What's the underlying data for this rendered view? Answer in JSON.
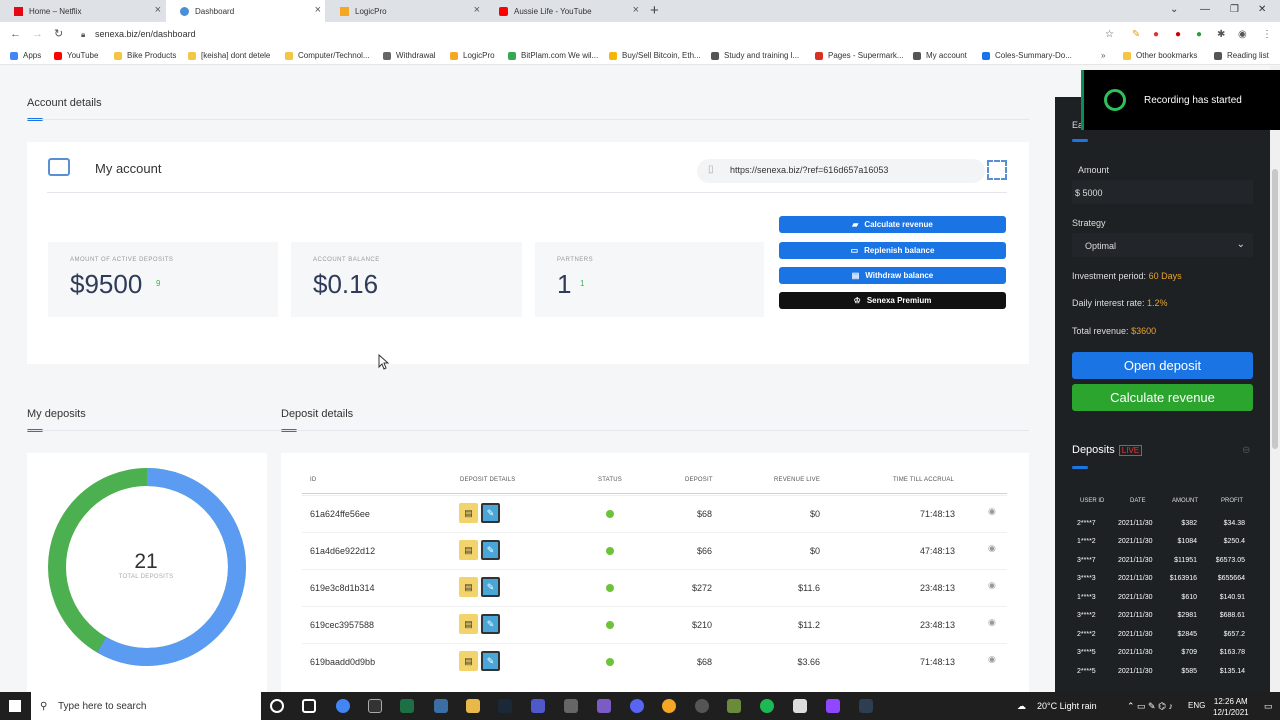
{
  "browser": {
    "tabs": [
      {
        "title": "Home – Netflix",
        "color": "#e50914"
      },
      {
        "title": "Dashboard",
        "color": "#4a90d9"
      },
      {
        "title": "LogicPro",
        "color": "#f5a623"
      },
      {
        "title": "Aussie Life - YouTube",
        "color": "#ff0000"
      }
    ],
    "url": "senexa.biz/en/dashboard",
    "bookmarks": [
      {
        "label": "Apps",
        "color": "#4285f4"
      },
      {
        "label": "YouTube",
        "color": "#ff0000"
      },
      {
        "label": "Bike Products",
        "color": "#f4c542"
      },
      {
        "label": "[keisha] dont detele",
        "color": "#f4c542"
      },
      {
        "label": "Computer/Technol...",
        "color": "#f4c542"
      },
      {
        "label": "Withdrawal",
        "color": "#666666"
      },
      {
        "label": "LogicPro",
        "color": "#f5a623"
      },
      {
        "label": "BitPlam.com We wil...",
        "color": "#34a853"
      },
      {
        "label": "Buy/Sell Bitcoin, Eth...",
        "color": "#f7b600"
      },
      {
        "label": "Study and training l...",
        "color": "#555555"
      },
      {
        "label": "Pages - Supermark...",
        "color": "#d93025"
      },
      {
        "label": "My account",
        "color": "#555555"
      },
      {
        "label": "Coles-Summary-Do...",
        "color": "#1a73e8"
      },
      {
        "label": "Other bookmarks",
        "color": "#f4c542"
      },
      {
        "label": "Reading list",
        "color": "#555555"
      }
    ]
  },
  "account_section": {
    "title": "Account details",
    "my_account": "My account",
    "ref_link": "https://senexa.biz/?ref=616d657a16053",
    "stats": [
      {
        "label": "AMOUNT OF ACTIVE DEPOSITS",
        "value": "$9500",
        "sup": "9"
      },
      {
        "label": "ACCOUNT BALANCE",
        "value": "$0.16",
        "sup": ""
      },
      {
        "label": "PARTNERS",
        "value": "1",
        "sup": "1"
      }
    ],
    "actions": {
      "calculate": "Calculate revenue",
      "replenish": "Replenish balance",
      "withdraw": "Withdraw balance",
      "premium": "Senexa Premium"
    }
  },
  "my_deposits": {
    "title": "My deposits",
    "total": "21",
    "total_label": "TOTAL DEPOSITS"
  },
  "deposit_details": {
    "title": "Deposit details",
    "headers": [
      "ID",
      "DEPOSIT DETAILS",
      "STATUS",
      "DEPOSIT",
      "REVENUE LIVE",
      "TIME TILL ACCRUAL"
    ],
    "rows": [
      {
        "id": "61a624ffe56ee",
        "deposit": "$68",
        "revenue": "$0",
        "time": "71:48:13"
      },
      {
        "id": "61a4d6e922d12",
        "deposit": "$66",
        "revenue": "$0",
        "time": "47:48:13"
      },
      {
        "id": "619e3c8d1b314",
        "deposit": "$272",
        "revenue": "$11.6",
        "time": "23:48:13"
      },
      {
        "id": "619cec3957588",
        "deposit": "$210",
        "revenue": "$11.2",
        "time": "23:48:13"
      },
      {
        "id": "619baadd0d9bb",
        "deposit": "$68",
        "revenue": "$3.66",
        "time": "71:48:13"
      }
    ]
  },
  "calculator": {
    "heading": "Ea",
    "amount_label": "Amount",
    "amount_value": "$ 5000",
    "strategy_label": "Strategy",
    "strategy_value": "Optimal",
    "period_label": "Investment period:",
    "period_value": "60 Days",
    "rate_label": "Daily interest rate:",
    "rate_value": "1.2%",
    "total_label": "Total revenue:",
    "total_value": "$3600",
    "open_btn": "Open deposit",
    "calc_btn": "Calculate revenue"
  },
  "live_deposits": {
    "title": "Deposits",
    "live": "LIVE",
    "headers": [
      "USER ID",
      "DATE",
      "AMOUNT",
      "PROFIT"
    ],
    "rows": [
      [
        "2****7",
        "2021/11/30",
        "$382",
        "$34.38"
      ],
      [
        "1****2",
        "2021/11/30",
        "$1084",
        "$250.4"
      ],
      [
        "3****7",
        "2021/11/30",
        "$11951",
        "$6573.05"
      ],
      [
        "3****3",
        "2021/11/30",
        "$163916",
        "$655664"
      ],
      [
        "1****3",
        "2021/11/30",
        "$610",
        "$140.91"
      ],
      [
        "3****2",
        "2021/11/30",
        "$2981",
        "$688.61"
      ],
      [
        "2****2",
        "2021/11/30",
        "$2845",
        "$657.2"
      ],
      [
        "3****5",
        "2021/11/30",
        "$709",
        "$163.78"
      ],
      [
        "2****5",
        "2021/11/30",
        "$585",
        "$135.14"
      ]
    ]
  },
  "toast": "Recording has started",
  "taskbar": {
    "search_placeholder": "Type here to search",
    "weather": "20°C  Light rain",
    "lang": "ENG",
    "time": "12:26 AM",
    "date": "12/1/2021"
  },
  "colors": {
    "accent": "#1b74e4",
    "green": "#3bc43b",
    "dark_panel": "#1e2124",
    "highlight": "#e7a332"
  }
}
